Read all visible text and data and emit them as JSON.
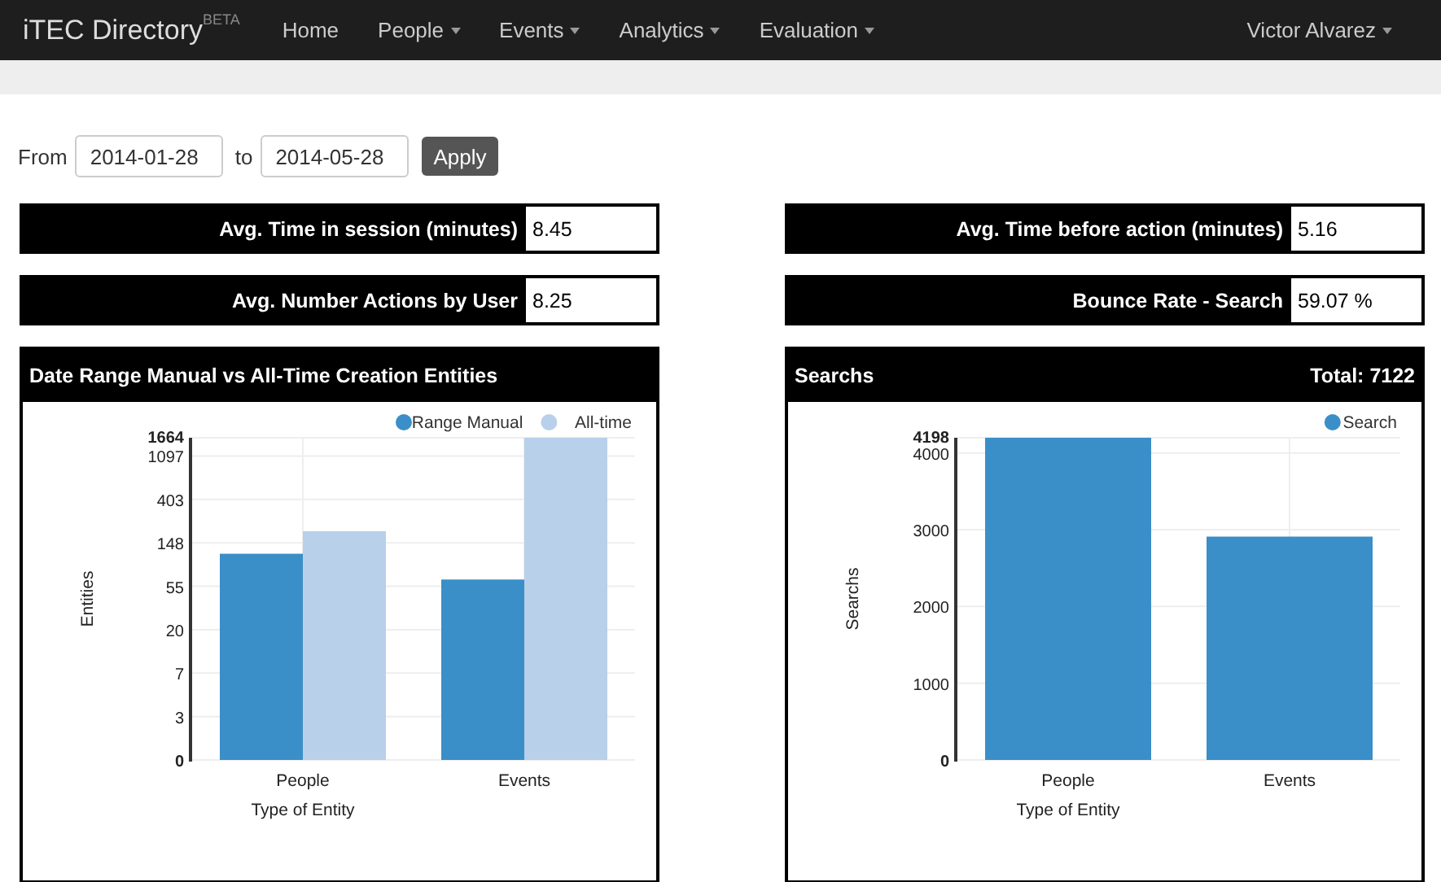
{
  "navbar": {
    "brand": "iTEC Directory",
    "brand_badge": "BETA",
    "items": [
      {
        "label": "Home",
        "dropdown": false
      },
      {
        "label": "People",
        "dropdown": true
      },
      {
        "label": "Events",
        "dropdown": true
      },
      {
        "label": "Analytics",
        "dropdown": true
      },
      {
        "label": "Evaluation",
        "dropdown": true
      }
    ],
    "user": {
      "label": "Victor Alvarez",
      "dropdown": true
    }
  },
  "date_filter": {
    "from_label": "From",
    "from": "2014-01-28",
    "to_label": "to",
    "to": "2014-05-28",
    "apply": "Apply"
  },
  "stats": [
    {
      "label": "Avg. Time in session (minutes)",
      "value": "8.45"
    },
    {
      "label": "Avg. Time before action (minutes)",
      "value": "5.16"
    },
    {
      "label": "Avg. Number Actions by User",
      "value": "8.25"
    },
    {
      "label": "Bounce Rate - Search",
      "value": "59.07 %"
    }
  ],
  "panels": [
    {
      "title": "Date Range Manual vs All-Time Creation Entities",
      "chart": {
        "kind": "picture",
        "xlabel": "Type of Entity",
        "ylabel": "Entities",
        "legend": [
          {
            "name": "Range Manual",
            "color": "#3a8fc8"
          },
          {
            "name": "All-time",
            "color": "#b8d0ea"
          }
        ],
        "y_labels": [
          "1664",
          "1097",
          "403",
          "148",
          "55",
          "20",
          "7",
          "3",
          "0"
        ],
        "groups": [
          {
            "label": "People"
          },
          {
            "label": "Events"
          }
        ]
      }
    },
    {
      "title": "Searchs",
      "total": "Total: 7122",
      "chart_data": {
        "type": "bar",
        "xlabel": "Type of Entity",
        "ylabel": "Searchs",
        "categories": [
          "People",
          "Events"
        ],
        "series": [
          {
            "name": "Search",
            "color": "#3a8fc8",
            "values": [
              4198,
              2910
            ]
          }
        ],
        "ylim": [
          0,
          4198
        ],
        "grid": true,
        "yticks": [
          0,
          1000,
          2000,
          3000,
          4000,
          4198
        ]
      }
    }
  ]
}
